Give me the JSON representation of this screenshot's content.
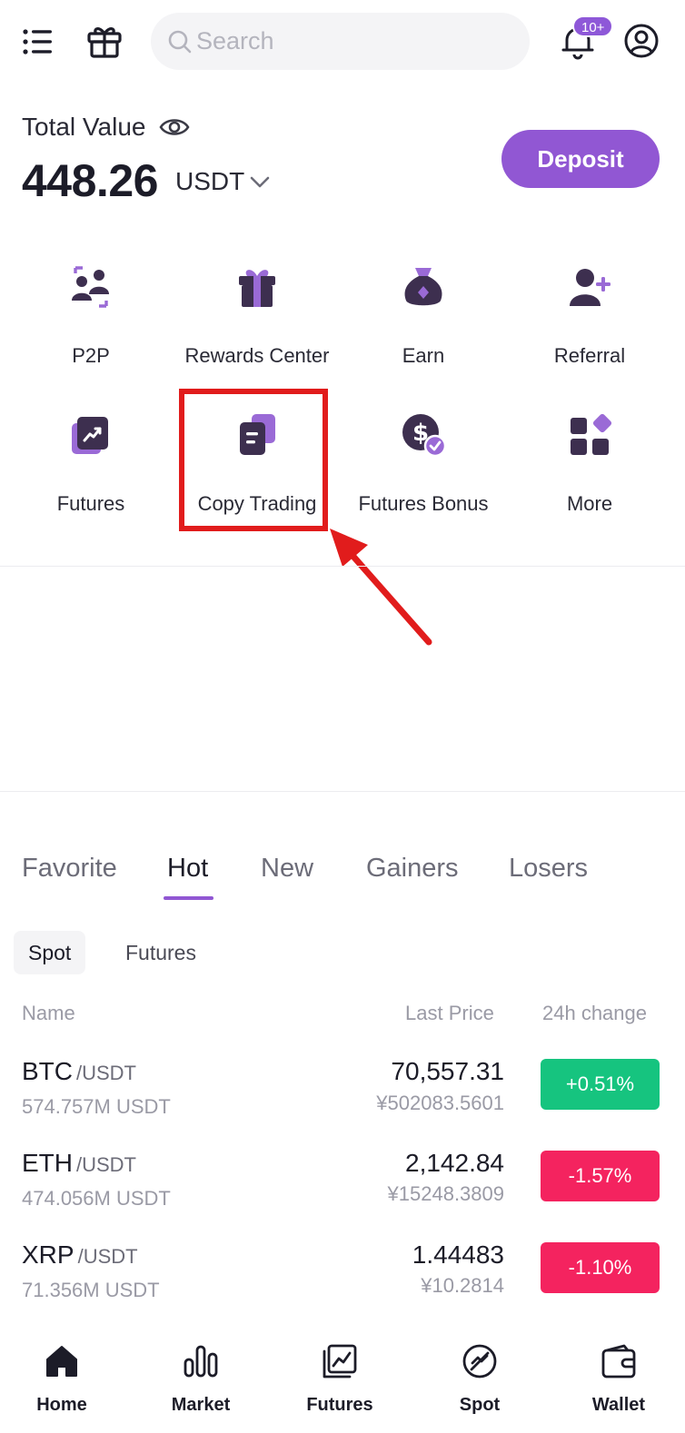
{
  "header": {
    "search_placeholder": "Search",
    "notification_badge": "10+"
  },
  "balance": {
    "label": "Total Value",
    "amount": "448.26",
    "currency": "USDT",
    "deposit_label": "Deposit"
  },
  "shortcuts": [
    {
      "label": "P2P",
      "icon": "p2p-icon"
    },
    {
      "label": "Rewards Center",
      "icon": "gift-box-icon"
    },
    {
      "label": "Earn",
      "icon": "money-bag-icon"
    },
    {
      "label": "Referral",
      "icon": "add-user-icon"
    },
    {
      "label": "Futures",
      "icon": "futures-chart-icon"
    },
    {
      "label": "Copy Trading",
      "icon": "copy-documents-icon"
    },
    {
      "label": "Futures Bonus",
      "icon": "dollar-check-icon"
    },
    {
      "label": "More",
      "icon": "grid-apps-icon"
    }
  ],
  "market": {
    "tabs": [
      "Favorite",
      "Hot",
      "New",
      "Gainers",
      "Losers"
    ],
    "active_tab": "Hot",
    "subtabs": [
      "Spot",
      "Futures"
    ],
    "active_subtab": "Spot",
    "columns": {
      "name": "Name",
      "last_price": "Last Price",
      "change": "24h change"
    },
    "rows": [
      {
        "base": "BTC",
        "quote": "/USDT",
        "volume": "574.757M USDT",
        "price": "70,557.31",
        "cny": "¥502083.5601",
        "change": "+0.51%",
        "direction": "up"
      },
      {
        "base": "ETH",
        "quote": "/USDT",
        "volume": "474.056M USDT",
        "price": "2,142.84",
        "cny": "¥15248.3809",
        "change": "-1.57%",
        "direction": "down"
      },
      {
        "base": "XRP",
        "quote": "/USDT",
        "volume": "71.356M USDT",
        "price": "1.44483",
        "cny": "¥10.2814",
        "change": "-1.10%",
        "direction": "down"
      }
    ]
  },
  "bottom_nav": [
    {
      "label": "Home",
      "icon": "home-icon"
    },
    {
      "label": "Market",
      "icon": "bar-chart-icon"
    },
    {
      "label": "Futures",
      "icon": "line-chart-icon"
    },
    {
      "label": "Spot",
      "icon": "spot-icon"
    },
    {
      "label": "Wallet",
      "icon": "wallet-icon"
    }
  ],
  "colors": {
    "accent": "#9157d3",
    "up": "#16c47f",
    "down": "#f4235f",
    "annotation": "#e11c1c"
  }
}
